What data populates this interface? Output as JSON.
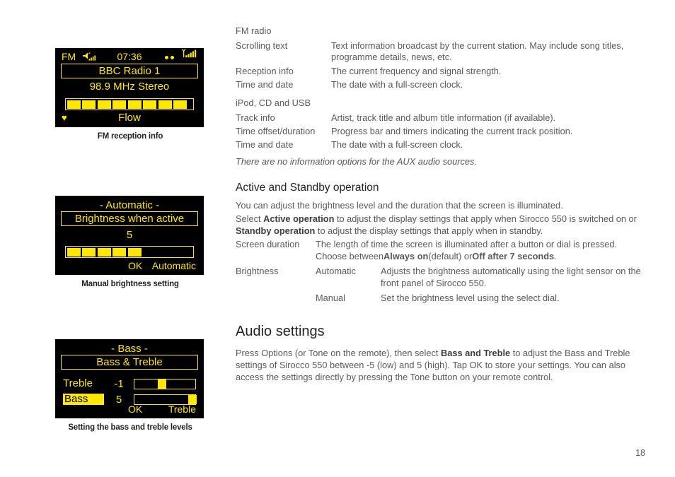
{
  "figures": [
    {
      "id": "fm-reception",
      "caption": "FM reception info",
      "status": {
        "mode": "FM",
        "clock": "07:36"
      },
      "title": "BBC Radio 1",
      "subline": "98.9 MHz Stereo",
      "meter_blocks_filled": 8,
      "bottom_center": "Flow",
      "favourite_icon": "♥"
    },
    {
      "id": "manual-brightness",
      "caption": "Manual brightness setting",
      "header": "- Automatic -",
      "title": "Brightness when active",
      "value": "5",
      "meter_blocks_filled": 5,
      "softkey_ok": "OK",
      "softkey_right": "Automatic"
    },
    {
      "id": "bass-treble",
      "caption": "Setting the bass and treble levels",
      "header": "- Bass -",
      "title": "Bass & Treble",
      "rows": [
        {
          "name": "Treble",
          "value": "-1",
          "selected": false,
          "knob_pct": 38
        },
        {
          "name": "Bass",
          "value": "5",
          "selected": true,
          "knob_pct": 88
        }
      ],
      "softkey_ok": "OK",
      "softkey_right": "Treble"
    }
  ],
  "content": {
    "fm_radio": {
      "heading": "FM radio",
      "rows": [
        {
          "term": "Scrolling text",
          "desc": "Text information broadcast by the current station. May include song titles, programme details, news, etc."
        },
        {
          "term": "Reception info",
          "desc": "The current frequency and signal strength."
        },
        {
          "term": "Time and date",
          "desc": "The date with a full-screen clock."
        }
      ]
    },
    "ipod_cd_usb": {
      "heading": "iPod, CD and USB",
      "rows": [
        {
          "term": "Track info",
          "desc": "Artist, track title and album title information (if available)."
        },
        {
          "term": "Time offset/duration",
          "desc": "Progress bar and timers indicating the current track position."
        },
        {
          "term": "Time and date",
          "desc": "The date with a full-screen clock."
        }
      ],
      "note": "There are no information options for the AUX audio sources."
    },
    "active_standby": {
      "heading": "Active and Standby operation",
      "p1": "You can adjust the brightness level and the duration that the screen is illuminated.",
      "p2_a": "Select ",
      "p2_b": "Active operation",
      "p2_c": " to adjust the display settings that apply when Sirocco 550 is switched on or ",
      "p2_d": "Standby operation",
      "p2_e": " to adjust the display settings that apply when in standby.",
      "screen_duration_term": "Screen duration",
      "screen_duration_desc": "The length of time the screen is illuminated after a button or dial is pressed.",
      "screen_duration_desc2_a": "Choose between ",
      "screen_duration_desc2_b": "Always on",
      "screen_duration_desc2_c": " (default) or ",
      "screen_duration_desc2_d": "Off after 7 seconds",
      "screen_duration_desc2_e": ".",
      "brightness_term": "Brightness",
      "brightness_auto_term": "Automatic",
      "brightness_auto_desc": "Adjusts the brightness automatically using the light sensor on the front panel of Sirocco 550.",
      "brightness_manual_term": "Manual",
      "brightness_manual_desc": "Set the brightness level using the select dial."
    },
    "audio_settings": {
      "heading": "Audio settings",
      "p_a": "Press Options (or Tone on the remote), then select ",
      "p_b": "Bass and Treble",
      "p_c": " to adjust the Bass and Treble settings of Sirocco 550 between -5 (low) and 5 (high). Tap OK to store your settings. You can also access the settings directly by pressing the Tone button on your remote control."
    }
  },
  "page_number": "18"
}
